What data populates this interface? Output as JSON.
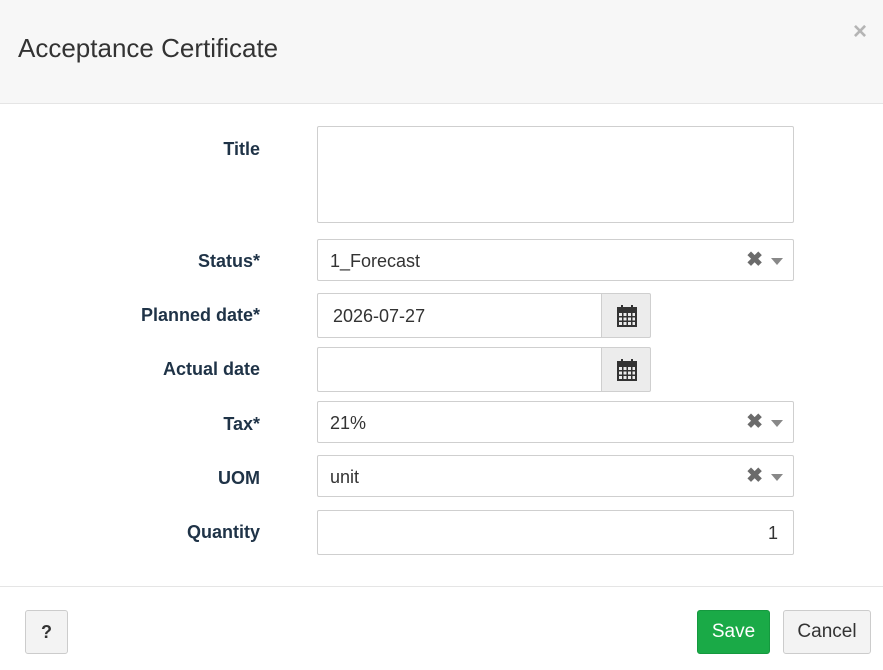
{
  "dialog": {
    "title": "Acceptance Certificate",
    "close_glyph": "×"
  },
  "form": {
    "title": {
      "label": "Title",
      "value": ""
    },
    "status": {
      "label": "Status*",
      "value": "1_Forecast",
      "clear_glyph": "✖"
    },
    "planned_date": {
      "label": "Planned date*",
      "value": "2026-07-27",
      "button_icon": "calendar-icon"
    },
    "actual_date": {
      "label": "Actual date",
      "value": "",
      "button_icon": "calendar-icon"
    },
    "tax": {
      "label": "Tax*",
      "value": "21%",
      "clear_glyph": "✖"
    },
    "uom": {
      "label": "UOM",
      "value": "unit",
      "clear_glyph": "✖"
    },
    "quantity": {
      "label": "Quantity",
      "value": "1"
    }
  },
  "footer": {
    "help_label": "?",
    "save_label": "Save",
    "cancel_label": "Cancel"
  },
  "colors": {
    "save": "#1aaa47",
    "label": "#1f3347",
    "header_bg": "#f7f7f7"
  }
}
